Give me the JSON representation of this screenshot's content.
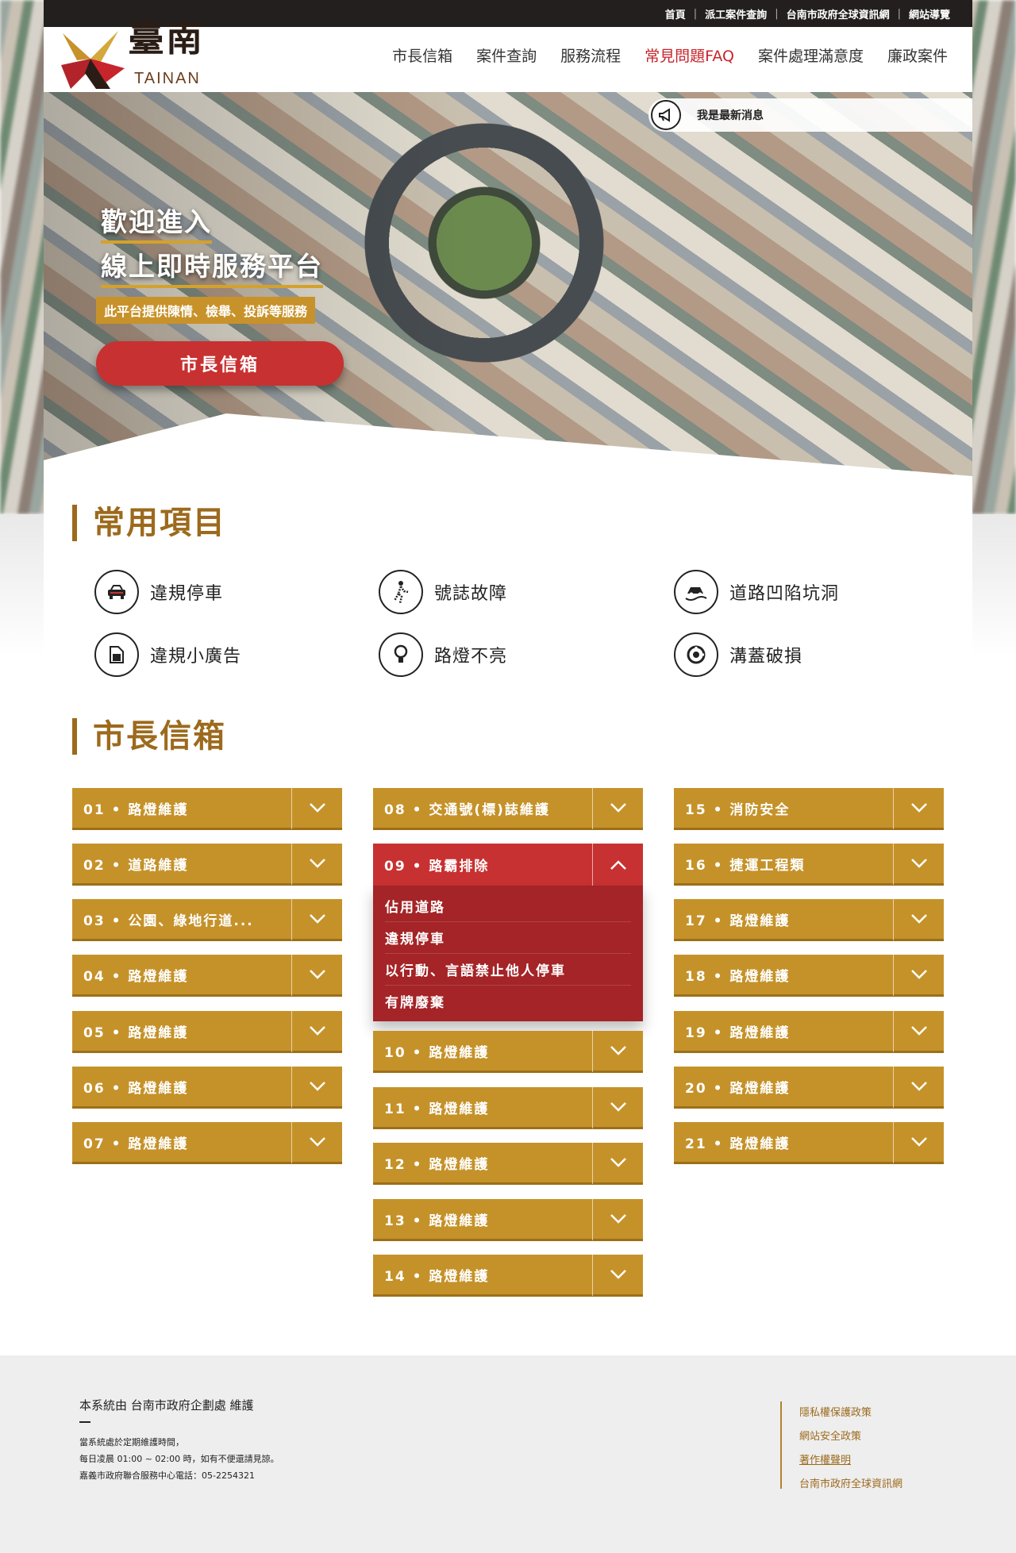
{
  "top_links": [
    "首頁",
    "派工案件查詢",
    "台南市政府全球資訊網",
    "網站導覽"
  ],
  "logo": {
    "text": "臺南",
    "sub": "TAINAN"
  },
  "nav": [
    {
      "label": "市長信箱",
      "active": false
    },
    {
      "label": "案件查詢",
      "active": false
    },
    {
      "label": "服務流程",
      "active": false
    },
    {
      "label": "常見問題FAQ",
      "active": true
    },
    {
      "label": "案件處理滿意度",
      "active": false
    },
    {
      "label": "廉政案件",
      "active": false
    }
  ],
  "news": {
    "label": "我是最新消息",
    "icon": "megaphone-icon"
  },
  "hero": {
    "title1": "歡迎進入",
    "title2": "線上即時服務平台",
    "tagline": "此平台提供陳情、檢舉、投訴等服務",
    "button": "市長信箱"
  },
  "quick": {
    "title": "常用項目",
    "items": [
      {
        "label": "違規停車",
        "icon": "car-icon"
      },
      {
        "label": "號誌故障",
        "icon": "pedestrian-signal-icon"
      },
      {
        "label": "道路凹陷坑洞",
        "icon": "pothole-car-icon"
      },
      {
        "label": "違規小廣告",
        "icon": "flyer-icon"
      },
      {
        "label": "路燈不亮",
        "icon": "bulb-icon"
      },
      {
        "label": "溝蓋破損",
        "icon": "drain-cover-icon"
      }
    ]
  },
  "mailbox": {
    "title": "市長信箱",
    "col1": [
      "01 • 路燈維護",
      "02 • 道路維護",
      "03 • 公園、綠地行道...",
      "04 • 路燈維護",
      "05 • 路燈維護",
      "06 • 路燈維護",
      "07 • 路燈維護"
    ],
    "col2_top": [
      "08 • 交通號(標)誌維護"
    ],
    "col2_open": {
      "label": "09 • 路霸排除",
      "items": [
        "佔用道路",
        "違規停車",
        "以行動、言語禁止他人停車",
        "有牌廢棄"
      ]
    },
    "col2_rest": [
      "10 • 路燈維護",
      "11 • 路燈維護",
      "12 • 路燈維護",
      "13 • 路燈維護",
      "14 • 路燈維護"
    ],
    "col3": [
      "15 • 消防安全",
      "16 • 捷運工程類",
      "17 • 路燈維護",
      "18 • 路燈維護",
      "19 • 路燈維護",
      "20 • 路燈維護",
      "21 • 路燈維護"
    ]
  },
  "footer": {
    "title": "本系統由 台南市政府企劃處 維護",
    "lines": [
      "當系統處於定期維護時間，",
      "每日凌晨 01:00 ~ 02:00 時，如有不便還請見諒。",
      "嘉義市政府聯合服務中心電話：05-2254321"
    ],
    "links": [
      "隱私權保護政策",
      "網站安全政策",
      "著作權聲明",
      "台南市政府全球資訊網"
    ]
  },
  "colors": {
    "gold": "#c5922a",
    "red": "#c83131",
    "dark_red": "#a42427",
    "brown": "#9c6a1d"
  }
}
